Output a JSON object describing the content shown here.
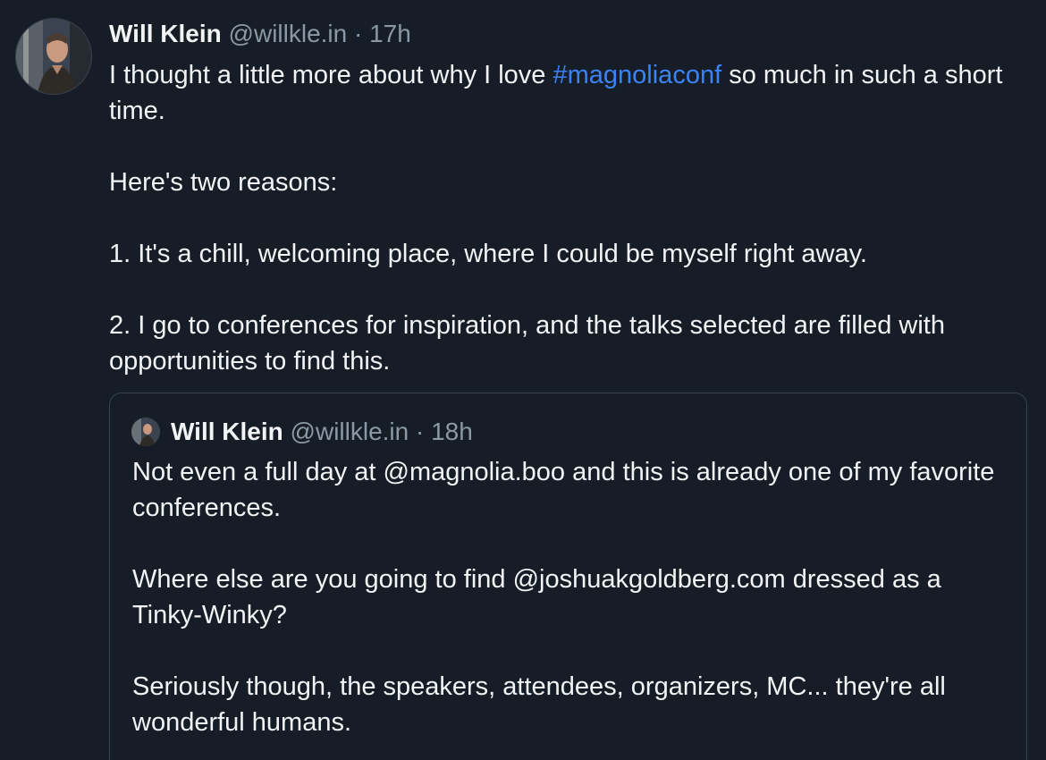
{
  "post": {
    "author_name": "Will Klein",
    "author_handle": "@willkle.in",
    "separator": "·",
    "timestamp": "17h",
    "text_line1_before": "I thought a little more about why I love ",
    "hashtag": "#magnoliaconf",
    "text_line1_after": " so much in such a short time.",
    "para2": "Here's two reasons:",
    "para3": "1. It's a chill, welcoming place, where I could be myself right away.",
    "para4": "2. I go to conferences for inspiration, and the talks selected are filled with opportunities to find this."
  },
  "quote": {
    "author_name": "Will Klein",
    "author_handle": "@willkle.in",
    "separator": "·",
    "timestamp": "18h",
    "para1": "Not even a full day at @magnolia.boo and this is already one of my favorite conferences.",
    "para2": "Where else are you going to find @joshuakgoldberg.com dressed as a Tinky-Winky?",
    "para3": "Seriously though, the speakers, attendees, organizers, MC... they're all wonderful humans."
  },
  "colors": {
    "background": "#171d26",
    "text": "#f1f3f5",
    "muted": "#8b98a5",
    "link": "#3b82f6",
    "border": "#3a4350"
  },
  "icons": {
    "avatar": "author-avatar",
    "quote_avatar": "quote-author-avatar"
  }
}
